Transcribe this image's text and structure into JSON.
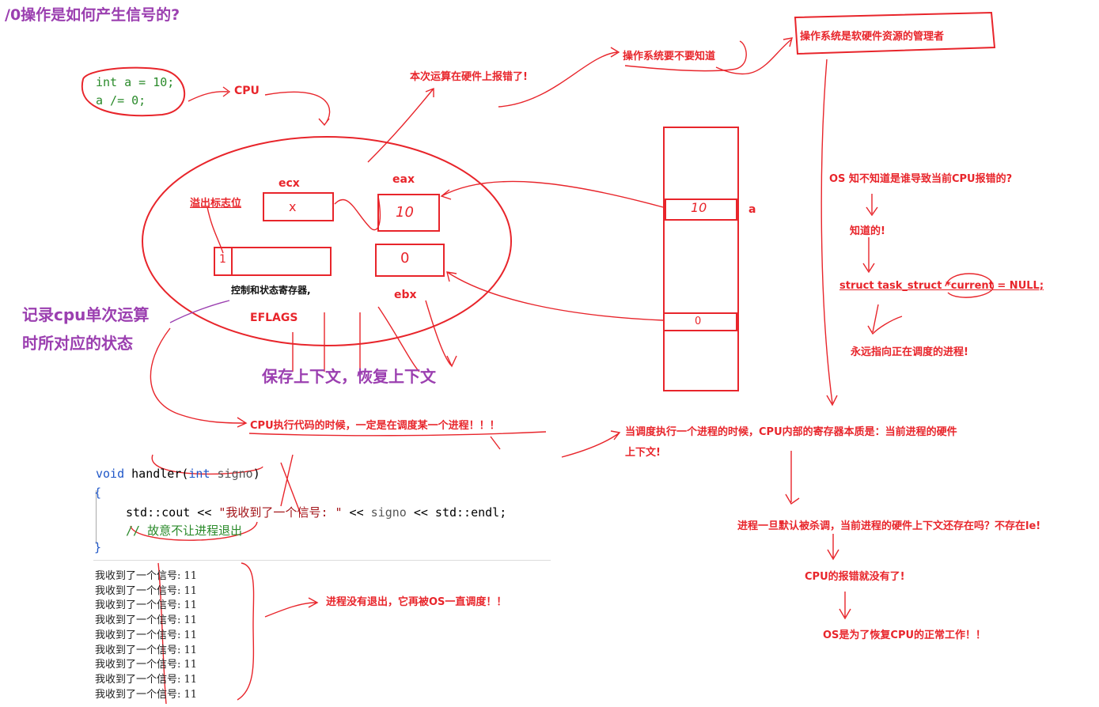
{
  "title": "/0操作是如何产生信号的?",
  "snippet": {
    "line1": "int a = 10;",
    "line2": "a /= 0;"
  },
  "labels": {
    "cpu": "CPU",
    "hw_error": "本次运算在硬件上报错了!",
    "os_need_know": "操作系统要不要知道",
    "os_manager": "操作系统是软硬件资源的管理者",
    "ecx": "ecx",
    "eax": "eax",
    "ebx": "ebx",
    "overflow_flag": "溢出标志位",
    "ctrl_status_reg": "控制和状态寄存器,",
    "eflags": "EFLAGS",
    "record_state_1": "记录cpu单次运算",
    "record_state_2": "时所对应的状态",
    "save_restore": "保存上下文，恢复上下文",
    "cpu_exec": "CPU执行代码的时候，一定是在调度某一个进程！！！",
    "var_a": "a",
    "os_know_q": "OS 知不知道是谁导致当前CPU报错的?",
    "knows": "知道的!",
    "current_decl": "struct task_struct *current = NULL;",
    "always_points": "永远指向正在调度的进程!",
    "schedule_ctx_1": "当调度执行一个进程的时候，CPU内部的寄存器本质是：当前进程的硬件",
    "schedule_ctx_2": "上下文!",
    "killed_q": "进程一旦默认被杀调，当前进程的硬件上下文还存在吗？不存在le!",
    "no_error": "CPU的报错就没有了!",
    "restore_cpu": "OS是为了恢复CPU的正常工作！！",
    "not_exit": "进程没有退出，它再被OS一直调度！！"
  },
  "register_marks": {
    "ecx": "x",
    "eax": "10",
    "ebx": "0",
    "eflags_bit": "1",
    "mem_a": "10",
    "mem_b": "0"
  },
  "handler_code": {
    "sig_void": "void",
    "sig_name": " handler(",
    "sig_int": "int",
    "sig_param": " signo",
    "sig_close": ")",
    "open_brace": "{",
    "body_prefix": "std::cout << ",
    "body_string": "\"我收到了一个信号: \"",
    "body_mid": " << ",
    "body_signo": "signo",
    "body_suffix": " << std::endl;",
    "comment": "// 故意不让进程退出",
    "close_brace": "}"
  },
  "output_lines": [
    "我收到了一个信号: 11",
    "我收到了一个信号: 11",
    "我收到了一个信号: 11",
    "我收到了一个信号: 11",
    "我收到了一个信号: 11",
    "我收到了一个信号: 11",
    "我收到了一个信号: 11",
    "我收到了一个信号: 11",
    "我收到了一个信号: 11"
  ],
  "colors": {
    "red": "#e8252b",
    "purple": "#9b3fb0",
    "code_blue": "#1f57c8",
    "code_green": "#2a8a2a"
  }
}
